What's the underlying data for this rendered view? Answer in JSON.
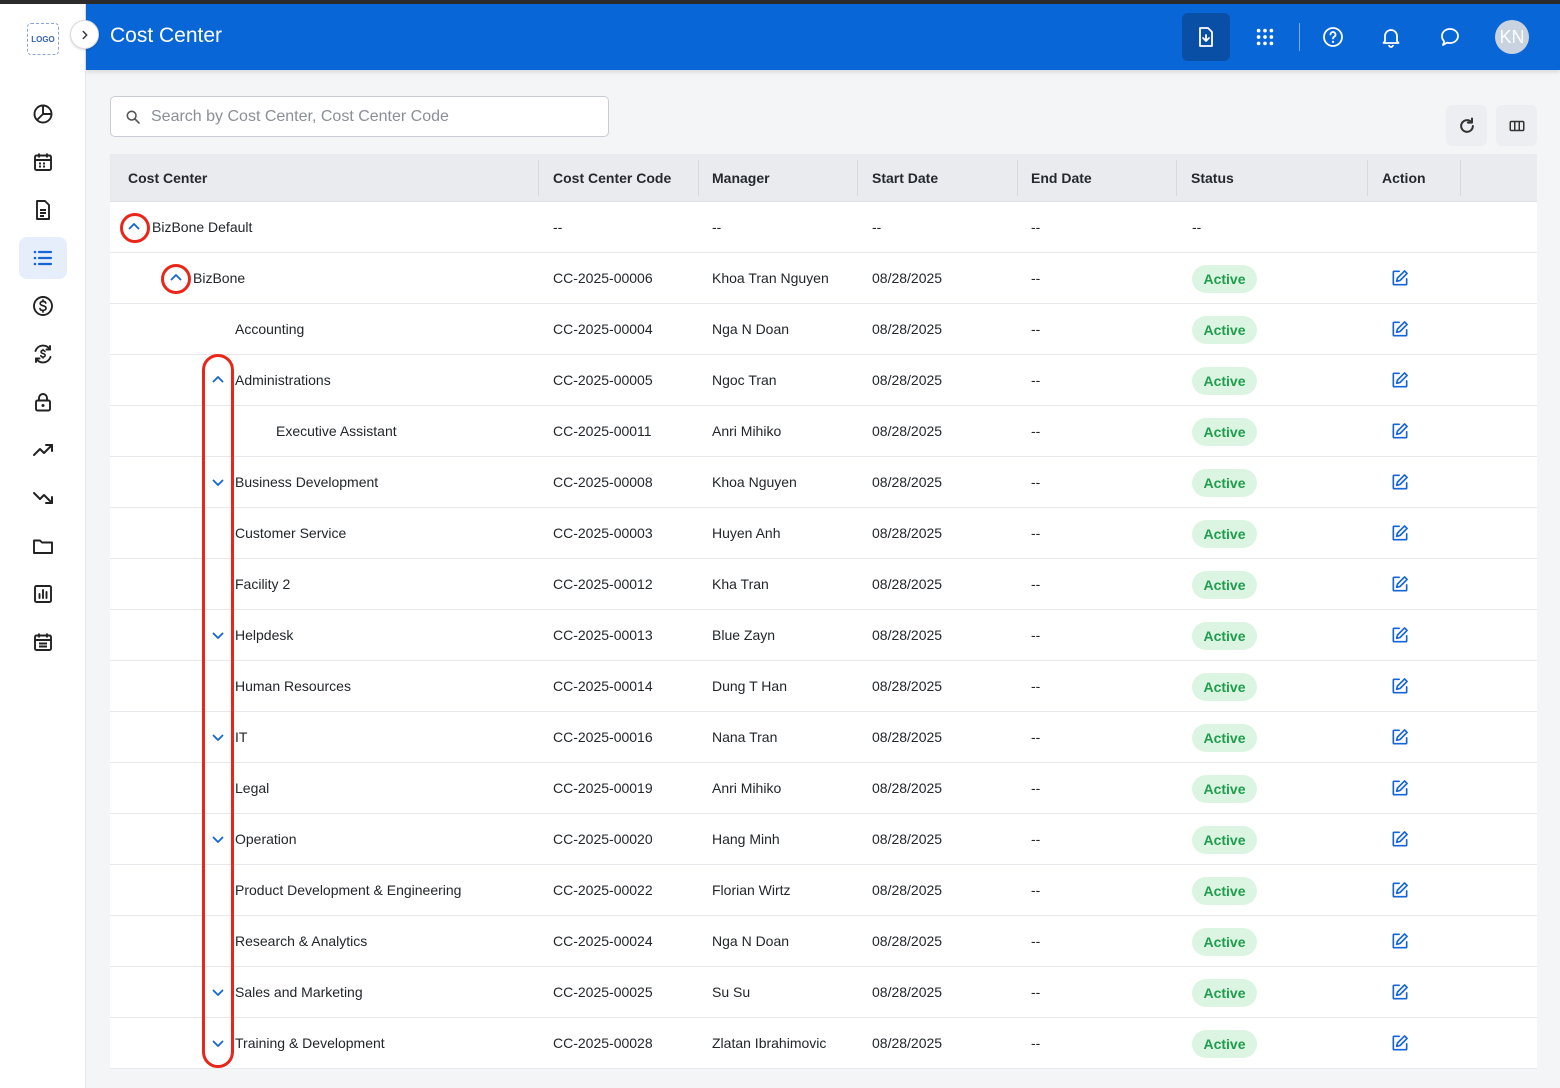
{
  "app": {
    "logo_text": "LOGO",
    "title": "Cost Center",
    "avatar_initials": "KN"
  },
  "sidebar": {
    "items": [
      {
        "icon": "pie-chart-icon",
        "active": false
      },
      {
        "icon": "calendar-icon",
        "active": false
      },
      {
        "icon": "document-icon",
        "active": false
      },
      {
        "icon": "list-icon",
        "active": true
      },
      {
        "icon": "dollar-icon",
        "active": false
      },
      {
        "icon": "currency-exchange-icon",
        "active": false
      },
      {
        "icon": "lock-icon",
        "active": false
      },
      {
        "icon": "trending-up-icon",
        "active": false
      },
      {
        "icon": "trending-down-icon",
        "active": false
      },
      {
        "icon": "folder-icon",
        "active": false
      },
      {
        "icon": "report-chart-icon",
        "active": false
      },
      {
        "icon": "calendar-list-icon",
        "active": false
      }
    ]
  },
  "header_icons": [
    "export-file-icon",
    "apps-grid-icon",
    "help-icon",
    "bell-icon",
    "chat-icon"
  ],
  "search": {
    "placeholder": "Search by Cost Center, Cost Center Code",
    "value": ""
  },
  "table": {
    "columns": [
      "Cost Center",
      "Cost Center Code",
      "Manager",
      "Start Date",
      "End Date",
      "Status",
      "Action"
    ],
    "rows": [
      {
        "name": "BizBone Default",
        "level": 0,
        "toggle": "up",
        "code": "--",
        "manager": "--",
        "start": "--",
        "end": "--",
        "status": "--",
        "action": false
      },
      {
        "name": "BizBone",
        "level": 1,
        "toggle": "up",
        "code": "CC-2025-00006",
        "manager": "Khoa Tran Nguyen",
        "start": "08/28/2025",
        "end": "--",
        "status": "Active",
        "action": true
      },
      {
        "name": "Accounting",
        "level": 2,
        "toggle": "none",
        "code": "CC-2025-00004",
        "manager": "Nga N Doan",
        "start": "08/28/2025",
        "end": "--",
        "status": "Active",
        "action": true
      },
      {
        "name": "Administrations",
        "level": 2,
        "toggle": "up",
        "code": "CC-2025-00005",
        "manager": "Ngoc Tran",
        "start": "08/28/2025",
        "end": "--",
        "status": "Active",
        "action": true
      },
      {
        "name": "Executive Assistant",
        "level": 3,
        "toggle": "none",
        "code": "CC-2025-00011",
        "manager": "Anri Mihiko",
        "start": "08/28/2025",
        "end": "--",
        "status": "Active",
        "action": true
      },
      {
        "name": "Business Development",
        "level": 2,
        "toggle": "down",
        "code": "CC-2025-00008",
        "manager": "Khoa Nguyen",
        "start": "08/28/2025",
        "end": "--",
        "status": "Active",
        "action": true
      },
      {
        "name": "Customer Service",
        "level": 2,
        "toggle": "none",
        "code": "CC-2025-00003",
        "manager": "Huyen Anh",
        "start": "08/28/2025",
        "end": "--",
        "status": "Active",
        "action": true
      },
      {
        "name": "Facility 2",
        "level": 2,
        "toggle": "none",
        "code": "CC-2025-00012",
        "manager": "Kha Tran",
        "start": "08/28/2025",
        "end": "--",
        "status": "Active",
        "action": true
      },
      {
        "name": "Helpdesk",
        "level": 2,
        "toggle": "down",
        "code": "CC-2025-00013",
        "manager": "Blue Zayn",
        "start": "08/28/2025",
        "end": "--",
        "status": "Active",
        "action": true
      },
      {
        "name": "Human Resources",
        "level": 2,
        "toggle": "none",
        "code": "CC-2025-00014",
        "manager": "Dung T Han",
        "start": "08/28/2025",
        "end": "--",
        "status": "Active",
        "action": true
      },
      {
        "name": "IT",
        "level": 2,
        "toggle": "down",
        "code": "CC-2025-00016",
        "manager": "Nana Tran",
        "start": "08/28/2025",
        "end": "--",
        "status": "Active",
        "action": true
      },
      {
        "name": "Legal",
        "level": 2,
        "toggle": "none",
        "code": "CC-2025-00019",
        "manager": "Anri Mihiko",
        "start": "08/28/2025",
        "end": "--",
        "status": "Active",
        "action": true
      },
      {
        "name": "Operation",
        "level": 2,
        "toggle": "down",
        "code": "CC-2025-00020",
        "manager": "Hang Minh",
        "start": "08/28/2025",
        "end": "--",
        "status": "Active",
        "action": true
      },
      {
        "name": "Product Development & Engineering",
        "level": 2,
        "toggle": "none",
        "code": "CC-2025-00022",
        "manager": "Florian Wirtz",
        "start": "08/28/2025",
        "end": "--",
        "status": "Active",
        "action": true
      },
      {
        "name": "Research & Analytics",
        "level": 2,
        "toggle": "none",
        "code": "CC-2025-00024",
        "manager": "Nga N Doan",
        "start": "08/28/2025",
        "end": "--",
        "status": "Active",
        "action": true
      },
      {
        "name": "Sales and Marketing",
        "level": 2,
        "toggle": "down",
        "code": "CC-2025-00025",
        "manager": "Su Su",
        "start": "08/28/2025",
        "end": "--",
        "status": "Active",
        "action": true
      },
      {
        "name": "Training & Development",
        "level": 2,
        "toggle": "down",
        "code": "CC-2025-00028",
        "manager": "Zlatan Ibrahimovic",
        "start": "08/28/2025",
        "end": "--",
        "status": "Active",
        "action": true
      }
    ]
  },
  "colors": {
    "header_bg": "#0866d6",
    "accent": "#1565d8",
    "status_active_bg": "#dcf5e3",
    "status_active_text": "#1f9d4c",
    "highlight": "#e8261a"
  }
}
